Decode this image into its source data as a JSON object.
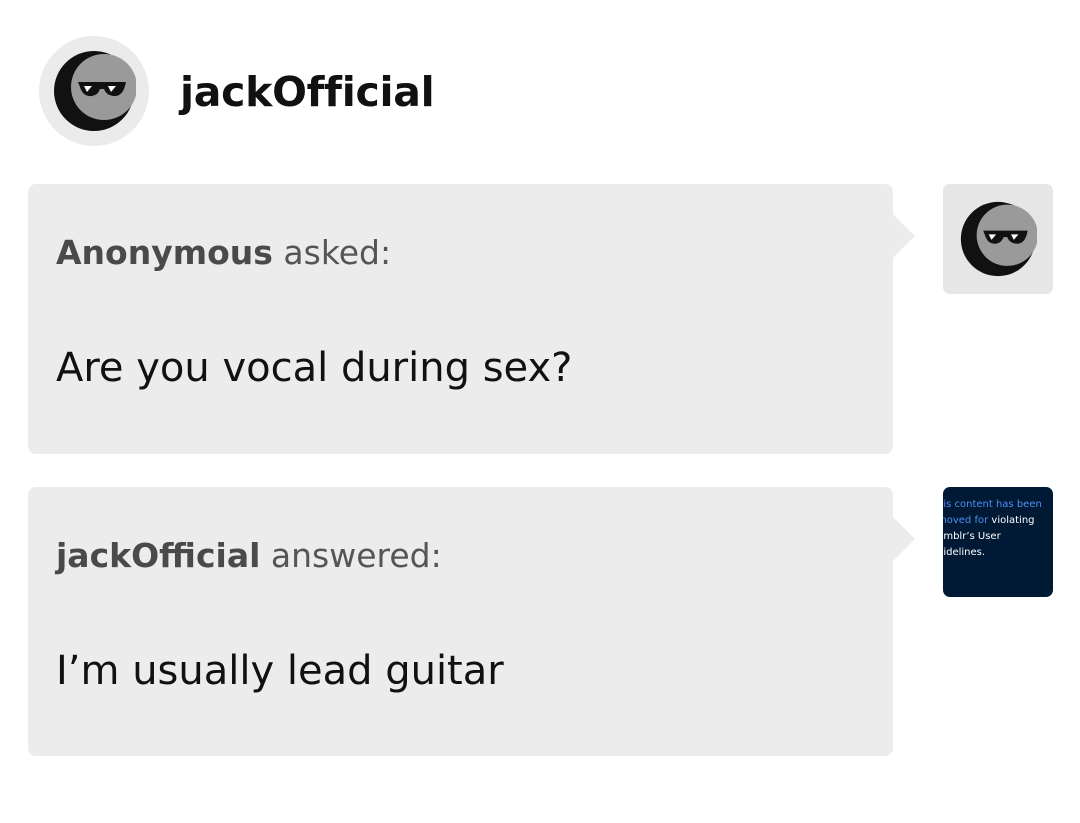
{
  "header": {
    "blog_name": "jackOfficial",
    "avatar_icon": "sunglasses-avatar-icon"
  },
  "ask": {
    "asker_name": "Anonymous",
    "verb": "asked:",
    "question": "Are you vocal during sex?"
  },
  "answer": {
    "answerer_name": "jackOfficial",
    "verb": "answered:",
    "text": "I’m usually lead guitar"
  },
  "removed_notice": {
    "line1": "his content has been",
    "line2_highlight": "moved for",
    "line2_rest": " violating",
    "line3": "umblr’s User",
    "line4": "uidelines."
  },
  "colors": {
    "bubble_bg": "#ececec",
    "removed_bg": "#001935",
    "removed_highlight": "#4f8ff0"
  }
}
